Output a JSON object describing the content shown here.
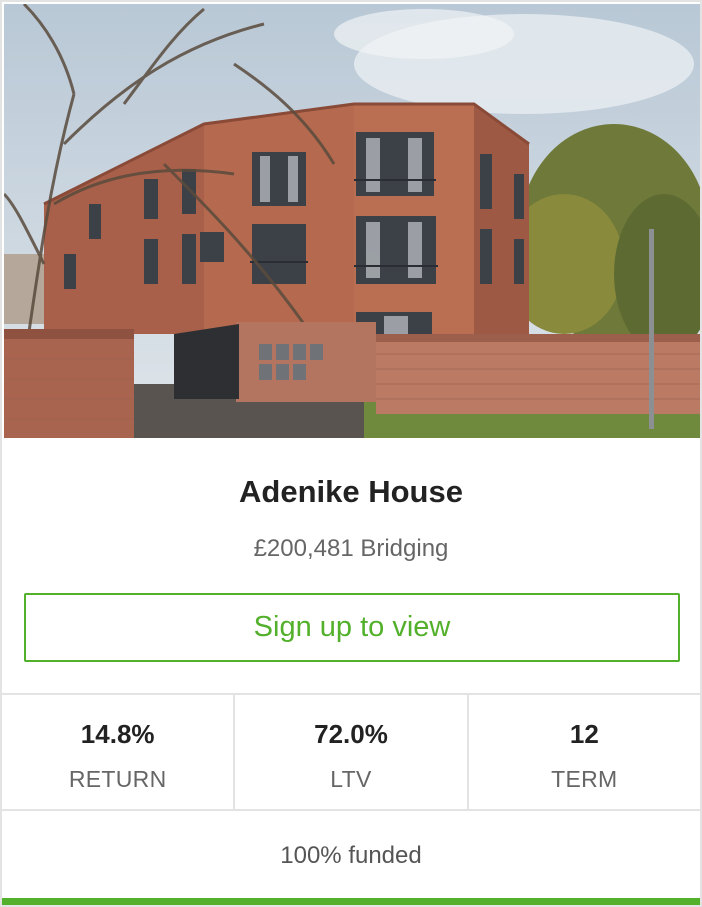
{
  "property": {
    "name": "Adenike House",
    "amount_type": "£200,481 Bridging",
    "image_description": "three-storey-brick-apartment-building"
  },
  "cta": {
    "label": "Sign up to view"
  },
  "stats": [
    {
      "value": "14.8%",
      "label": "RETURN"
    },
    {
      "value": "72.0%",
      "label": "LTV"
    },
    {
      "value": "12",
      "label": "TERM"
    }
  ],
  "funding": {
    "text": "100% funded",
    "fraction": 1.0
  },
  "colors": {
    "accent": "#52b02b",
    "border": "#e3e3e3",
    "title": "#222222",
    "muted": "#666666"
  }
}
